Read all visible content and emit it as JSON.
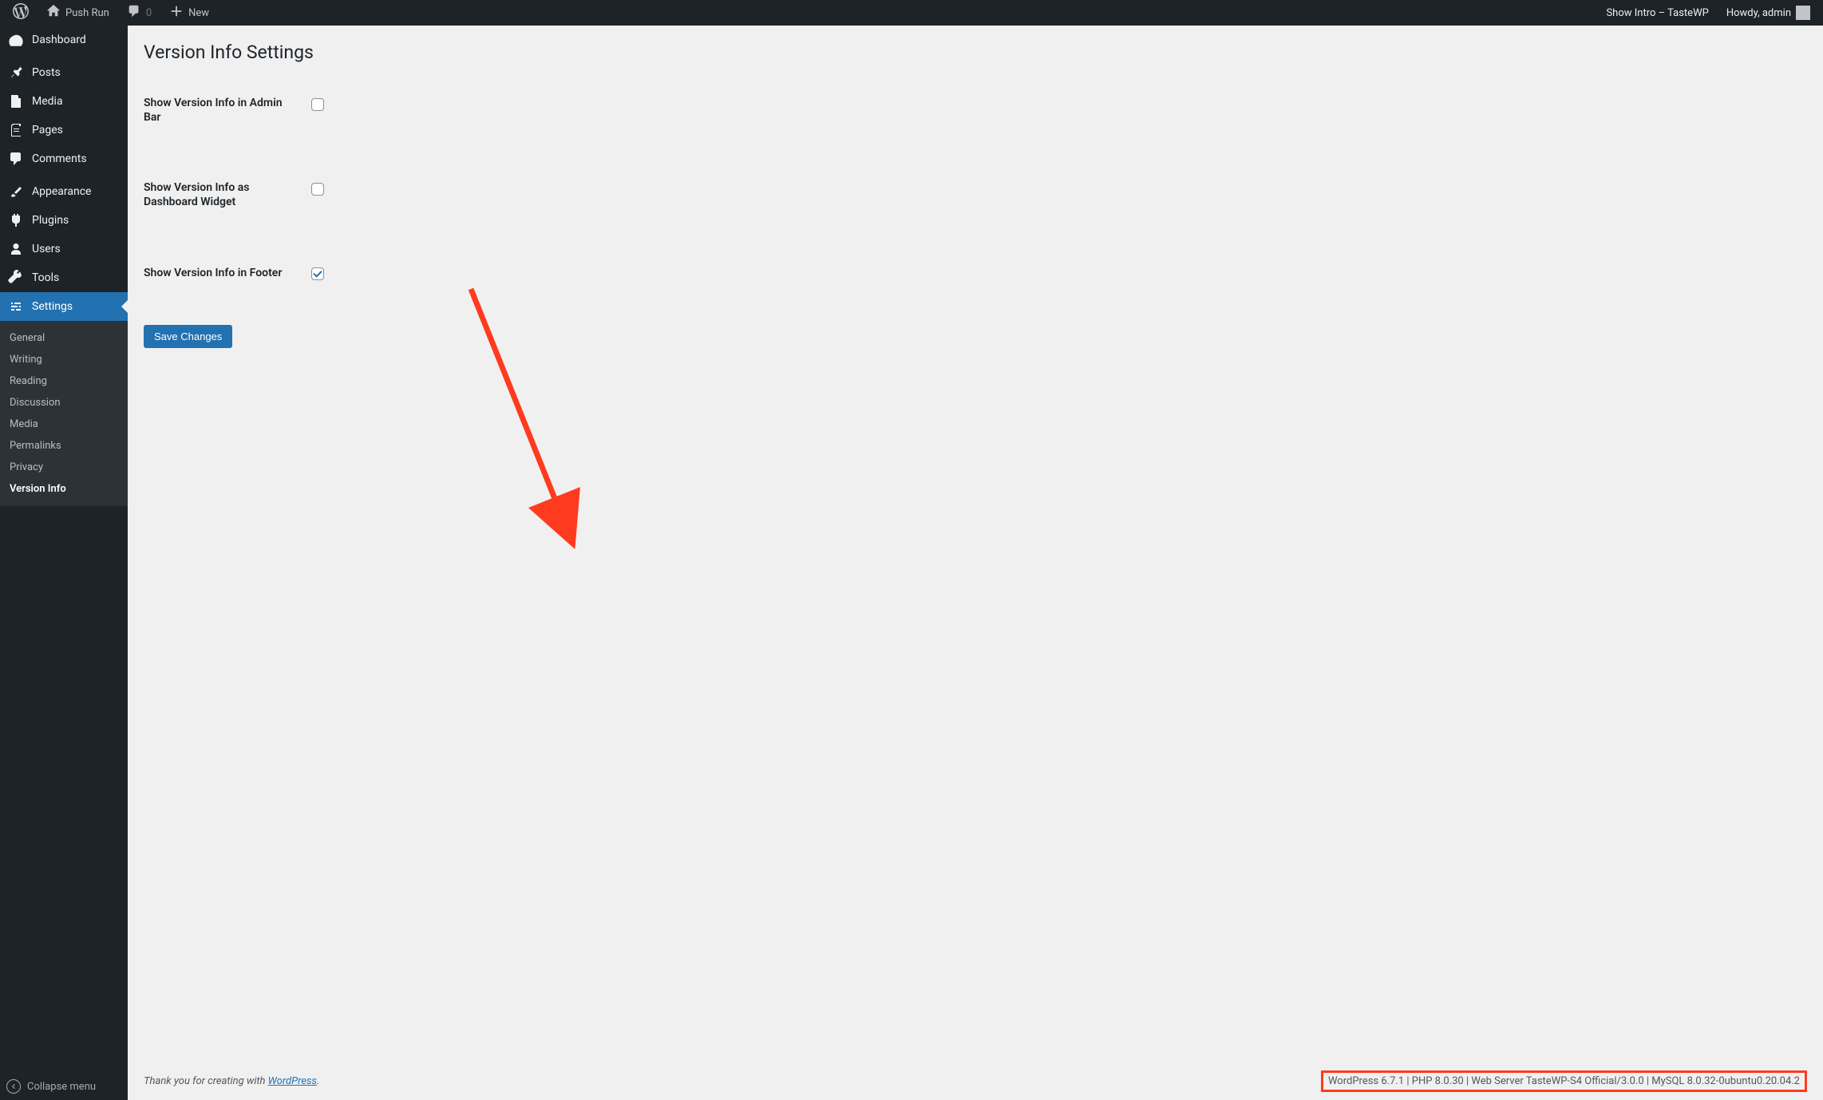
{
  "adminbar": {
    "site_name": "Push Run",
    "comments_count": "0",
    "new_label": "New",
    "show_intro": "Show Intro – TasteWP",
    "howdy": "Howdy, admin"
  },
  "sidebar": {
    "items": {
      "dashboard": "Dashboard",
      "posts": "Posts",
      "media": "Media",
      "pages": "Pages",
      "comments": "Comments",
      "appearance": "Appearance",
      "plugins": "Plugins",
      "users": "Users",
      "tools": "Tools",
      "settings": "Settings"
    },
    "submenu": {
      "general": "General",
      "writing": "Writing",
      "reading": "Reading",
      "discussion": "Discussion",
      "media": "Media",
      "permalinks": "Permalinks",
      "privacy": "Privacy",
      "version_info": "Version Info"
    },
    "collapse": "Collapse menu"
  },
  "page": {
    "title": "Version Info Settings",
    "fields": {
      "admin_bar": "Show Version Info in Admin Bar",
      "dashboard_widget": "Show Version Info as Dashboard Widget",
      "footer": "Show Version Info in Footer"
    },
    "save": "Save Changes"
  },
  "footer": {
    "thank_you_prefix": "Thank you for creating with ",
    "wordpress_link": "WordPress",
    "thank_you_suffix": ".",
    "version_info": "WordPress 6.7.1 | PHP 8.0.30 | Web Server TasteWP-S4 Official/3.0.0 | MySQL 8.0.32-0ubuntu0.20.04.2"
  }
}
